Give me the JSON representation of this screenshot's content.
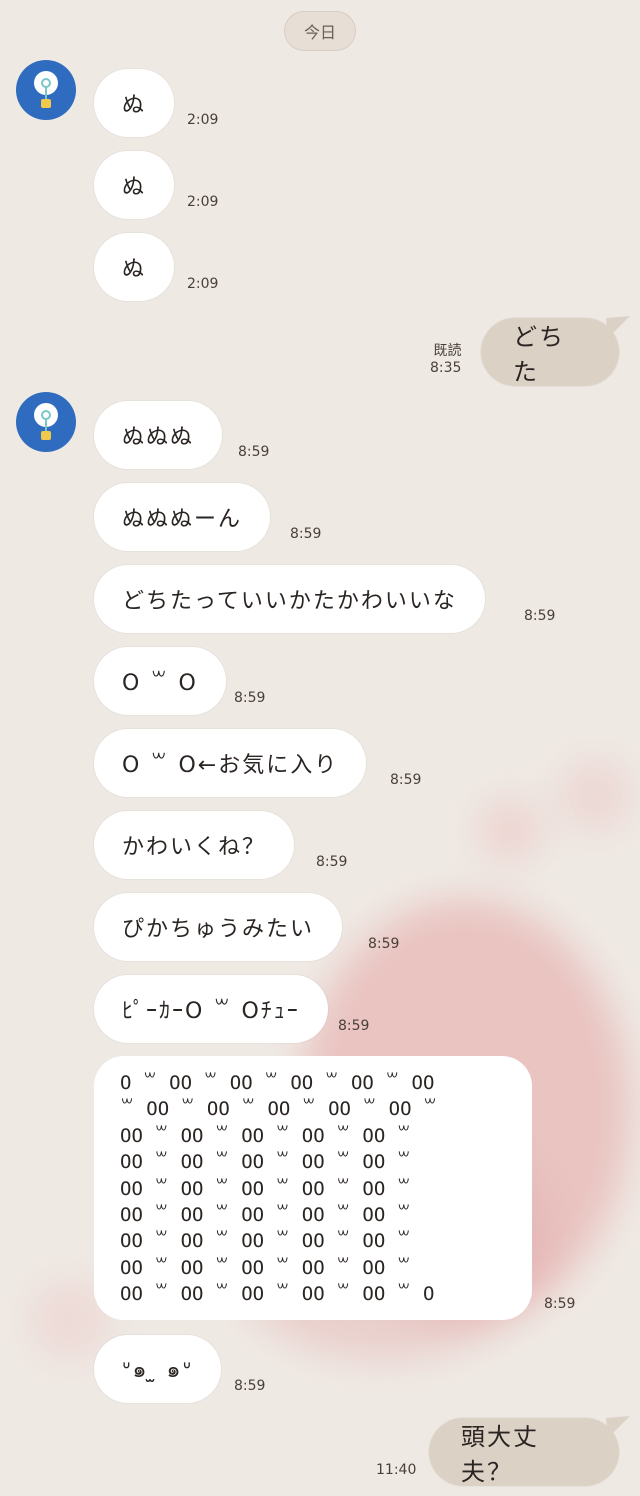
{
  "date_label": "今日",
  "messages": [
    {
      "text": "ぬ",
      "time": "2:09"
    },
    {
      "text": "ぬ",
      "time": "2:09"
    },
    {
      "text": "ぬ",
      "time": "2:09"
    },
    {
      "text": "どちた",
      "time": "8:35",
      "read": "既読"
    },
    {
      "text": "ぬぬぬ",
      "time": "8:59"
    },
    {
      "text": "ぬぬぬーん",
      "time": "8:59"
    },
    {
      "text": "どちたっていいかたかわいいな",
      "time": "8:59"
    },
    {
      "text": "O ꒳ O",
      "time": "8:59"
    },
    {
      "text": "O ꒳ O←お気に入り",
      "time": "8:59"
    },
    {
      "text": "かわいくね？",
      "time": "8:59"
    },
    {
      "text": "ぴかちゅうみたい",
      "time": "8:59"
    },
    {
      "text": "ﾋﾟｰｶｰO ꒳ Oﾁｭｰ",
      "time": "8:59"
    },
    {
      "text": "O ꒳ OO ꒳ OO ꒳ OO ꒳ OO ꒳ OO\n꒳ OO ꒳ OO ꒳ OO ꒳ OO ꒳ OO ꒳\nOO ꒳ OO ꒳ OO ꒳ OO ꒳ OO ꒳\nOO ꒳ OO ꒳ OO ꒳ OO ꒳ OO ꒳\nOO ꒳ OO ꒳ OO ꒳ OO ꒳ OO ꒳\nOO ꒳ OO ꒳ OO ꒳ OO ꒳ OO ꒳\nOO ꒳ OO ꒳ OO ꒳ OO ꒳ OO ꒳\nOO ꒳ OO ꒳ OO ꒳ OO ꒳ OO ꒳\nOO ꒳ OO ꒳ OO ꒳ OO ꒳ OO ꒳ O",
      "time": "8:59"
    },
    {
      "text": "ᐡ๑ ̫ ๑ᐡ",
      "time": "8:59"
    },
    {
      "text": "頭大丈夫？",
      "time": "11:40"
    }
  ],
  "colors": {
    "background": "#efe9e4",
    "incoming_bubble": "#ffffff",
    "outgoing_bubble": "#dcd1c5",
    "avatar": "#2f6cc0"
  },
  "icons": {
    "avatar": "lightbulb-icon"
  }
}
